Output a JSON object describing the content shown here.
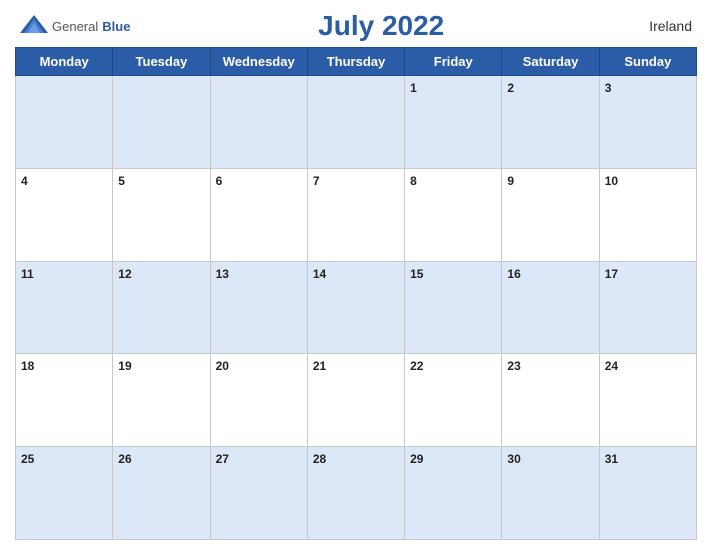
{
  "header": {
    "logo": {
      "general": "General",
      "blue": "Blue"
    },
    "title": "July 2022",
    "country": "Ireland"
  },
  "calendar": {
    "days_of_week": [
      "Monday",
      "Tuesday",
      "Wednesday",
      "Thursday",
      "Friday",
      "Saturday",
      "Sunday"
    ],
    "weeks": [
      [
        null,
        null,
        null,
        null,
        1,
        2,
        3
      ],
      [
        4,
        5,
        6,
        7,
        8,
        9,
        10
      ],
      [
        11,
        12,
        13,
        14,
        15,
        16,
        17
      ],
      [
        18,
        19,
        20,
        21,
        22,
        23,
        24
      ],
      [
        25,
        26,
        27,
        28,
        29,
        30,
        31
      ]
    ]
  }
}
